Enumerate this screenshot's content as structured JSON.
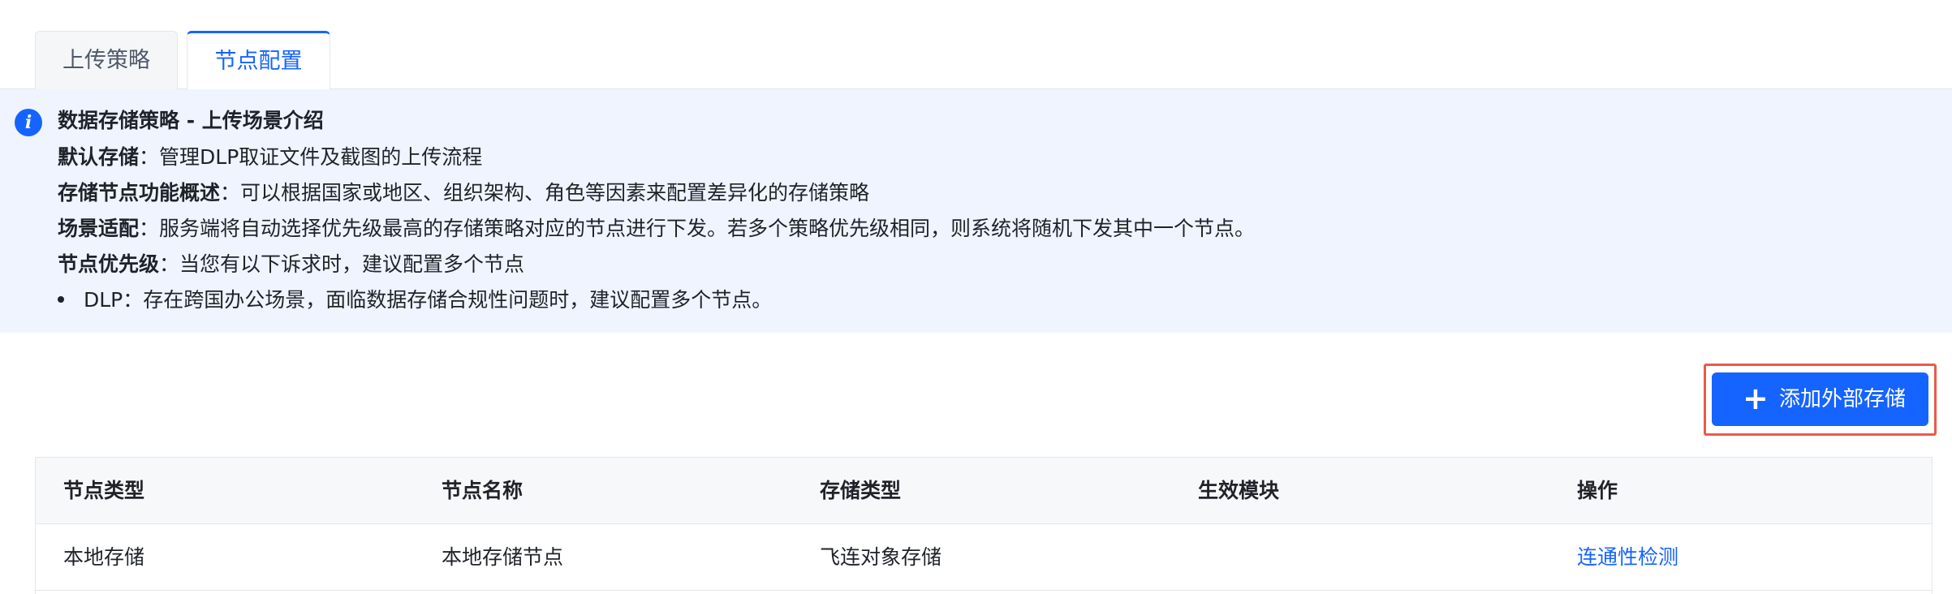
{
  "tabs": [
    {
      "label": "上传策略",
      "active": false
    },
    {
      "label": "节点配置",
      "active": true
    }
  ],
  "info": {
    "icon": "info-icon",
    "title": "数据存储策略 - 上传场景介绍",
    "lines": [
      {
        "label": "默认存储",
        "text": "管理DLP取证文件及截图的上传流程"
      },
      {
        "label": "存储节点功能概述",
        "text": "可以根据国家或地区、组织架构、角色等因素来配置差异化的存储策略"
      },
      {
        "label": "场景适配",
        "text": "服务端将自动选择优先级最高的存储策略对应的节点进行下发。若多个策略优先级相同，则系统将随机下发其中一个节点。"
      },
      {
        "label": "节点优先级",
        "text": "当您有以下诉求时，建议配置多个节点"
      }
    ],
    "bullet": "DLP：存在跨国办公场景，面临数据存储合规性问题时，建议配置多个节点。",
    "colon": "："
  },
  "add_button": {
    "label": "添加外部存储",
    "icon": "plus-icon"
  },
  "table": {
    "columns": [
      "节点类型",
      "节点名称",
      "存储类型",
      "生效模块",
      "操作"
    ],
    "rows": [
      {
        "type": "本地存储",
        "name": "本地存储节点",
        "storage": "飞连对象存储",
        "module": "",
        "action": "连通性检测"
      }
    ]
  },
  "colors": {
    "accent": "#1664ff",
    "banner_bg": "#eff4ff",
    "highlight_border": "#ea5b4b"
  }
}
